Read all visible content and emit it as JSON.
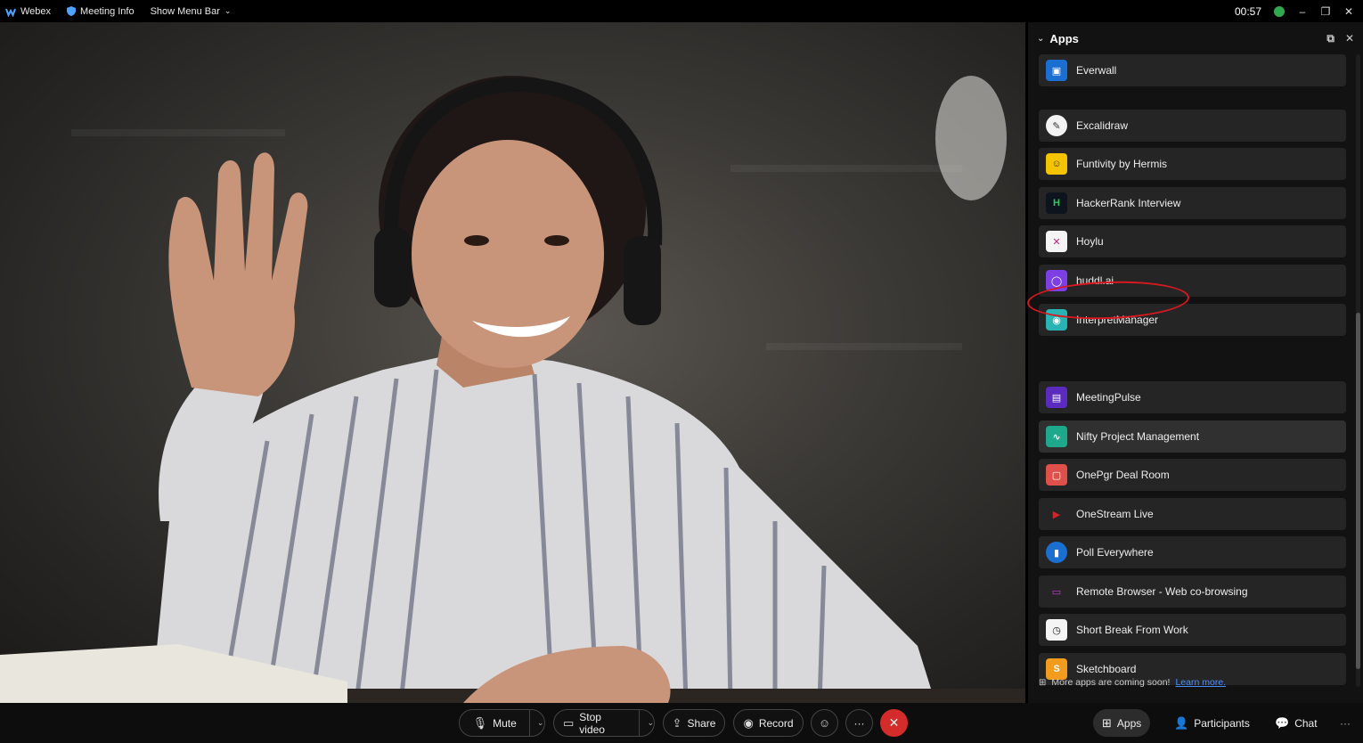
{
  "titlebar": {
    "app_name": "Webex",
    "meeting_info": "Meeting Info",
    "show_menu_bar": "Show Menu Bar",
    "timer": "00:57"
  },
  "apps_panel": {
    "title": "Apps",
    "items": [
      {
        "name": "Everwall",
        "icon_color": "#1a6fd1",
        "icon_glyph": "▣"
      },
      {
        "name": "Excalidraw",
        "icon_color": "#f2f2f2",
        "icon_glyph": "✎"
      },
      {
        "name": "Funtivity by Hermis",
        "icon_color": "#f5c400",
        "icon_glyph": "☺"
      },
      {
        "name": "HackerRank Interview",
        "icon_color": "#0e141e",
        "icon_glyph": "H"
      },
      {
        "name": "Hoylu",
        "icon_color": "#f4f4f4",
        "icon_glyph": "✕"
      },
      {
        "name": "huddl.ai",
        "icon_color": "#7b3fe4",
        "icon_glyph": "◯"
      },
      {
        "name": "InterpretManager",
        "icon_color": "#2ab3b3",
        "icon_glyph": "◉"
      },
      {
        "name": "MeetingPulse",
        "icon_color": "#5b2bc0",
        "icon_glyph": "▤"
      },
      {
        "name": "Nifty Project Management",
        "icon_color": "#1fa98c",
        "icon_glyph": "∿"
      },
      {
        "name": "OnePgr Deal Room",
        "icon_color": "#e0504a",
        "icon_glyph": "▢"
      },
      {
        "name": "OneStream Live",
        "icon_color": "#d0252a",
        "icon_glyph": "▶"
      },
      {
        "name": "Poll Everywhere",
        "icon_color": "#1a6fd1",
        "icon_glyph": "▮"
      },
      {
        "name": "Remote Browser - Web co-browsing",
        "icon_color": "#3a2a5c",
        "icon_glyph": "▭"
      },
      {
        "name": "Short Break From Work",
        "icon_color": "#f4f4f4",
        "icon_glyph": "◷"
      },
      {
        "name": "Sketchboard",
        "icon_color": "#f29b1d",
        "icon_glyph": "S"
      }
    ],
    "more_apps_text": "More apps are coming soon!",
    "learn_more": "Learn more."
  },
  "controls": {
    "mute": "Mute",
    "stop_video": "Stop video",
    "share": "Share",
    "record": "Record",
    "more": "···",
    "apps": "Apps",
    "participants": "Participants",
    "chat": "Chat"
  },
  "colors": {
    "accent_end": "#d42b2b",
    "annotation": "#d9191f",
    "link": "#4f8ef7"
  }
}
